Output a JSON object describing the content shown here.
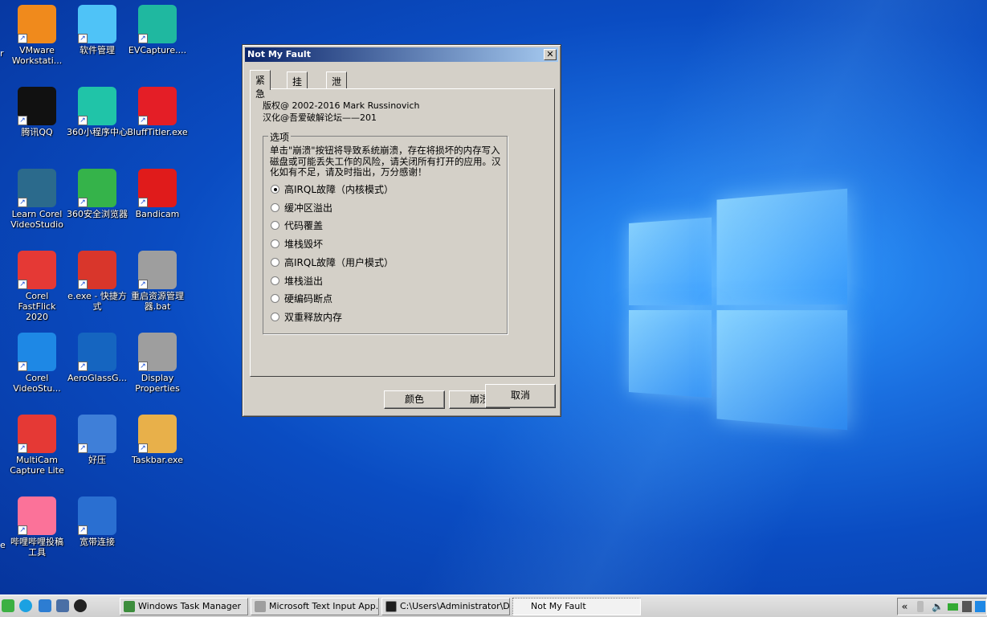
{
  "desktop": {
    "icons": [
      {
        "label": "VMware Workstati...",
        "icon": "vmware-icon",
        "color": "#f08a1c"
      },
      {
        "label": "软件管理",
        "icon": "software-manager-icon",
        "color": "#4fc3f7"
      },
      {
        "label": "EVCapture....",
        "icon": "evcapture-icon",
        "color": "#1fb8a0"
      },
      {
        "label": "腾讯QQ",
        "icon": "qq-penguin-icon",
        "color": "#111111"
      },
      {
        "label": "360小程序中心",
        "icon": "360-miniapp-icon",
        "color": "#20c4a8"
      },
      {
        "label": "BluffTitler.exe",
        "icon": "blufftitler-icon",
        "color": "#e41e26"
      },
      {
        "label": "Learn Corel VideoStudio",
        "icon": "corel-training-icon",
        "color": "#2b6a8c"
      },
      {
        "label": "360安全浏览器",
        "icon": "360-browser-icon",
        "color": "#35b34a"
      },
      {
        "label": "Bandicam",
        "icon": "bandicam-icon",
        "color": "#e01b1b"
      },
      {
        "label": "Corel FastFlick 2020",
        "icon": "fastflick-icon",
        "color": "#e53935"
      },
      {
        "label": "e.exe - 快捷方式",
        "icon": "e-exe-icon",
        "color": "#d9362b"
      },
      {
        "label": "重启资源管理器.bat",
        "icon": "bat-gear-icon",
        "color": "#9e9e9e"
      },
      {
        "label": "Corel VideoStu...",
        "icon": "videostudio-icon",
        "color": "#1e88e5"
      },
      {
        "label": "AeroGlassG...",
        "icon": "aeroglass-icon",
        "color": "#1565c0"
      },
      {
        "label": "Display Properties",
        "icon": "display-gear-icon",
        "color": "#9e9e9e"
      },
      {
        "label": "MultiCam Capture Lite",
        "icon": "multicam-icon",
        "color": "#e53935"
      },
      {
        "label": "好压",
        "icon": "haozip-icon",
        "color": "#3f7fd8"
      },
      {
        "label": "Taskbar.exe",
        "icon": "palette-icon",
        "color": "#e8b04a"
      },
      {
        "label": "哔哩哔哩投稿工具",
        "icon": "bilibili-icon",
        "color": "#fb7299"
      },
      {
        "label": "宽带连接",
        "icon": "broadband-icon",
        "color": "#2a6fd1"
      }
    ],
    "clipped_left_text_1": "r",
    "clipped_left_text_2": "e"
  },
  "dialog": {
    "title": "Not My Fault",
    "close_glyph": "✕",
    "tabs": [
      "紧急",
      "挂起",
      "泄露"
    ],
    "copyright_line1": "版权@ 2002-2016 Mark Russinovich",
    "copyright_line2": "汉化@吾爱破解论坛——201",
    "group_label": "选项",
    "description": "单击\"崩溃\"按钮将导致系统崩溃，存在将损坏的内存写入磁盘或可能丢失工作的风险，请关闭所有打开的应用。汉化如有不足，请及时指出，万分感谢！",
    "options": [
      {
        "label": "高IRQL故障（内核模式）",
        "selected": true
      },
      {
        "label": "缓冲区溢出",
        "selected": false
      },
      {
        "label": "代码覆盖",
        "selected": false
      },
      {
        "label": "堆栈毁坏",
        "selected": false
      },
      {
        "label": "高IRQL故障（用户模式）",
        "selected": false
      },
      {
        "label": "堆栈溢出",
        "selected": false
      },
      {
        "label": "硬编码断点",
        "selected": false
      },
      {
        "label": "双重释放内存",
        "selected": false
      }
    ],
    "color_button": "颜色",
    "crash_button": "崩溃",
    "cancel_button": "取消"
  },
  "taskbar": {
    "quick_launch": [
      "show-desktop-icon",
      "edge-icon",
      "desktop-icon",
      "explorer-icon",
      "qq-icon"
    ],
    "buttons": [
      {
        "label": "Windows Task Manager",
        "active": false
      },
      {
        "label": "Microsoft Text Input App...",
        "active": false
      },
      {
        "label": "C:\\Users\\Administrator\\D...",
        "active": false
      },
      {
        "label": "Not My Fault",
        "active": true
      }
    ],
    "tray": {
      "chevron": "«",
      "icons": [
        "usb-icon",
        "volume-icon",
        "battery-icon",
        "network-icon",
        "security-icon"
      ]
    }
  }
}
